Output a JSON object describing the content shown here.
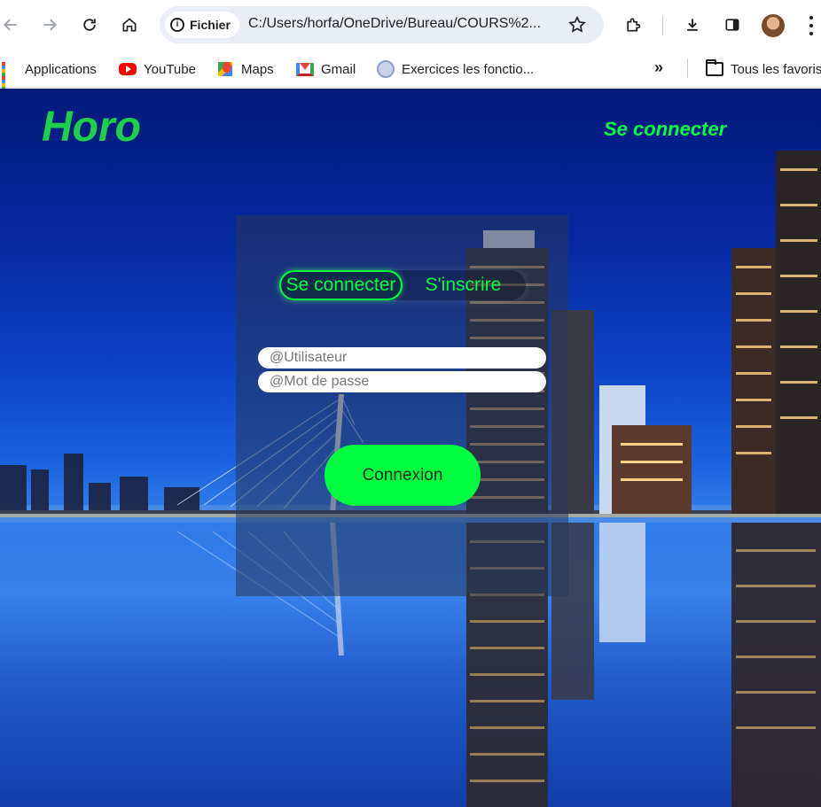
{
  "browser": {
    "url_chip": "Fichier",
    "url": "C:/Users/horfa/OneDrive/Bureau/COURS%2...",
    "bookmarks": [
      {
        "label": "Applications",
        "icon": "apps-grid-icon"
      },
      {
        "label": "YouTube",
        "icon": "youtube-icon"
      },
      {
        "label": "Maps",
        "icon": "maps-icon"
      },
      {
        "label": "Gmail",
        "icon": "gmail-icon"
      },
      {
        "label": "Exercices les fonctio...",
        "icon": "exercise-site-icon"
      }
    ],
    "all_bookmarks": "Tous les favoris",
    "overflow_label": "»"
  },
  "site": {
    "logo": "Horo",
    "top_link": "Se connecter",
    "colors": {
      "accent": "#00ff40",
      "logo": "#1bd14a"
    }
  },
  "form": {
    "tab_login": "Se connecter",
    "tab_signup": "S'inscrire",
    "username_placeholder": "@Utilisateur",
    "password_placeholder": "@Mot de passe",
    "submit_label": "Connexion"
  }
}
